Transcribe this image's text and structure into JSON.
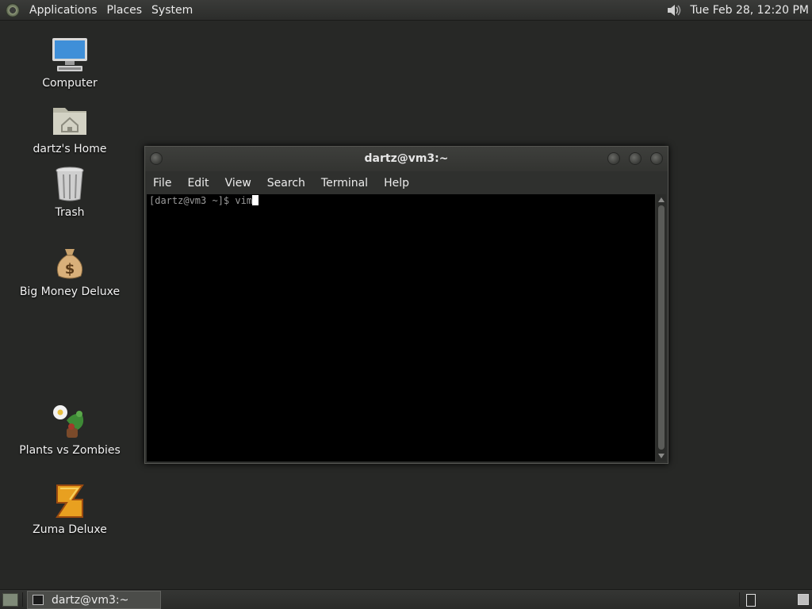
{
  "top_panel": {
    "menus": [
      "Applications",
      "Places",
      "System"
    ],
    "clock": "Tue Feb 28, 12:20 PM"
  },
  "desktop_icons": [
    {
      "label": "Computer",
      "icon": "computer-icon"
    },
    {
      "label": "dartz's Home",
      "icon": "home-folder-icon"
    },
    {
      "label": "Trash",
      "icon": "trash-icon"
    },
    {
      "label": "Big Money Deluxe",
      "icon": "money-bag-icon"
    },
    {
      "label": "Plants vs Zombies",
      "icon": "plants-vs-zombies-icon"
    },
    {
      "label": "Zuma Deluxe",
      "icon": "zuma-icon"
    }
  ],
  "terminal": {
    "title": "dartz@vm3:~",
    "menu": [
      "File",
      "Edit",
      "View",
      "Search",
      "Terminal",
      "Help"
    ],
    "prompt_line": "[dartz@vm3 ~]$ vim"
  },
  "taskbar": {
    "task_label": "dartz@vm3:~"
  },
  "colors": {
    "desktop_bg": "#272826",
    "terminal_bg": "#000000",
    "panel_bg": "#2c2d2b"
  }
}
